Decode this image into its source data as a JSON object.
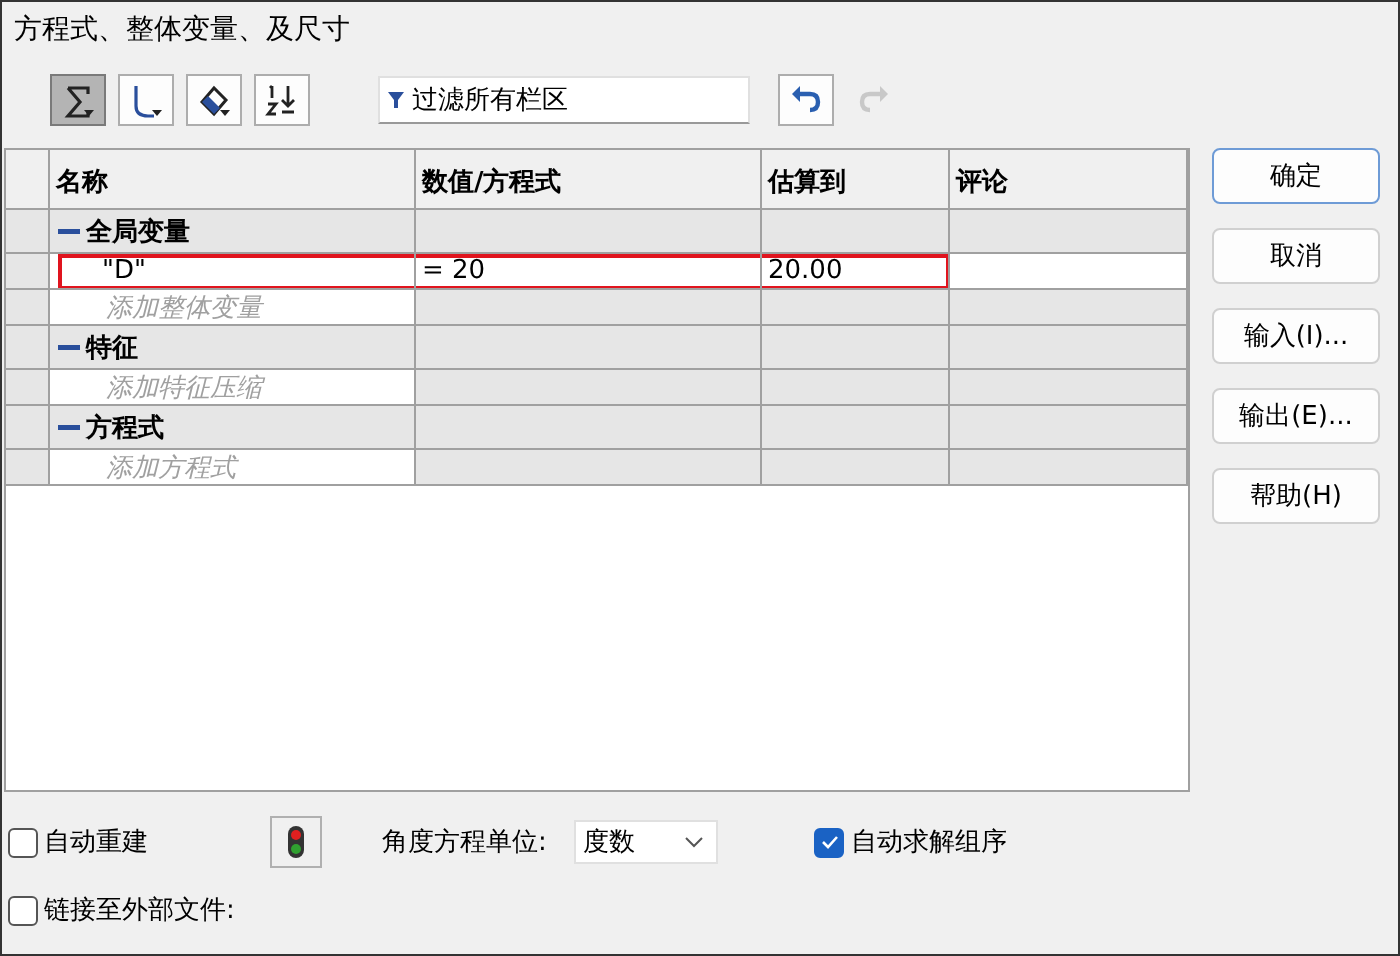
{
  "window": {
    "title": "方程式、整体变量、及尺寸"
  },
  "toolbar": {
    "tools": [
      {
        "kind": "sigma",
        "selected": true
      },
      {
        "kind": "curve",
        "selected": false
      },
      {
        "kind": "eraser",
        "selected": false
      },
      {
        "kind": "order",
        "selected": false
      }
    ],
    "filter": {
      "placeholder": "过滤所有栏区"
    },
    "undo": {
      "disabled": false
    },
    "redo": {
      "disabled": true
    }
  },
  "table": {
    "columns": [
      "名称",
      "数值/方程式",
      "估算到",
      "评论"
    ],
    "groups": [
      {
        "name": "全局变量",
        "expanded": true,
        "rows": [
          {
            "name": "\"D\"",
            "value": "= 20",
            "evaluates_to": "20.00",
            "highlighted": true
          }
        ],
        "add_hint": "添加整体变量"
      },
      {
        "name": "特征",
        "expanded": true,
        "add_hint": "添加特征压缩"
      },
      {
        "name": "方程式",
        "expanded": true,
        "add_hint": "添加方程式"
      }
    ]
  },
  "buttons": [
    {
      "label": "确定",
      "default": true
    },
    {
      "label": "取消",
      "default": false
    },
    {
      "label": "输入(I)...",
      "default": false
    },
    {
      "label": "输出(E)...",
      "default": false
    },
    {
      "label": "帮助(H)",
      "default": false
    }
  ],
  "footer": {
    "auto_rebuild": {
      "label": "自动重建",
      "checked": false
    },
    "angle_unit": {
      "label": "角度方程单位:",
      "value": "度数"
    },
    "auto_solve": {
      "label": "自动求解组序",
      "checked": true
    },
    "link_external": {
      "label": "链接至外部文件:",
      "checked": false
    }
  }
}
